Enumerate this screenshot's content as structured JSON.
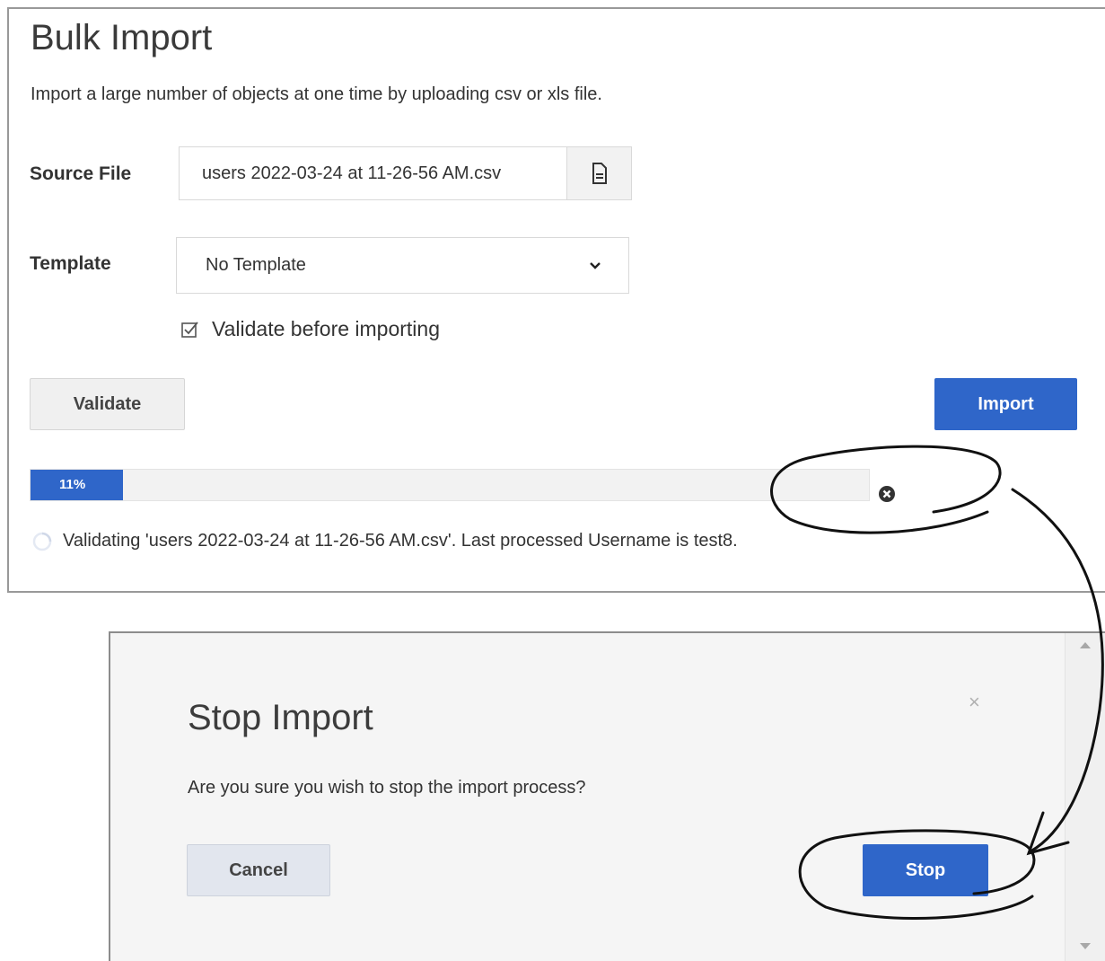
{
  "bulk_import": {
    "title": "Bulk Import",
    "description": "Import a large number of objects at one time by uploading csv or xls file.",
    "source_file": {
      "label": "Source File",
      "value": "users 2022-03-24 at 11-26-56 AM.csv",
      "icon": "file-icon"
    },
    "template": {
      "label": "Template",
      "selected": "No Template",
      "icon": "chevron-down-icon"
    },
    "validate_checkbox": {
      "label": "Validate before importing",
      "checked": true
    },
    "validate_button": "Validate",
    "import_button": "Import",
    "progress": {
      "percent": 11,
      "label": "11%"
    },
    "status": "Validating 'users 2022-03-24 at 11-26-56 AM.csv'. Last processed Username is test8."
  },
  "dialog": {
    "title": "Stop Import",
    "close": "×",
    "message": "Are you sure you wish to stop the import process?",
    "cancel_button": "Cancel",
    "stop_button": "Stop"
  },
  "colors": {
    "accent": "#2f66c9",
    "dialog_bg": "#f5f5f5",
    "secondary_btn": "#e2e6ee"
  }
}
